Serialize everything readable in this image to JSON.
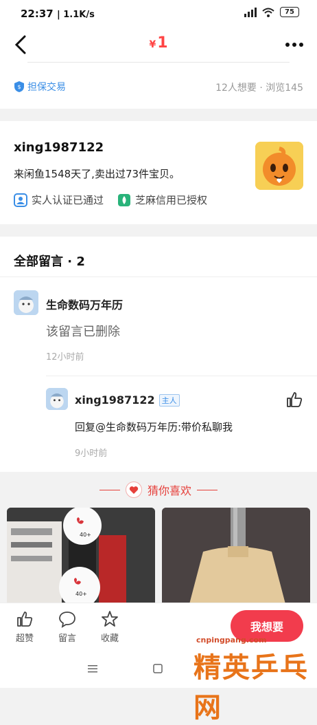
{
  "status_bar": {
    "time": "22:37",
    "speed": "| 1.1K/s",
    "battery": "75"
  },
  "nav": {
    "currency": "¥",
    "price": "1"
  },
  "guarantee": {
    "label": "担保交易",
    "stats": "12人想要 · 浏览145"
  },
  "seller": {
    "name": "xing1987122",
    "description": "来闲鱼1548天了,卖出过73件宝贝。",
    "badge_verified": "实人认证已通过",
    "badge_credit": "芝麻信用已授权"
  },
  "comments": {
    "title": "全部留言 · 2",
    "items": [
      {
        "user": "生命数码万年历",
        "text": "该留言已删除",
        "time": "12小时前"
      },
      {
        "user": "xing1987122",
        "tag": "主人",
        "text": "回复@生命数码万年历:带价私聊我",
        "time": "9小时前"
      }
    ]
  },
  "recommend": {
    "title": "猜你喜欢"
  },
  "actions": {
    "like": "超赞",
    "comment": "留言",
    "favorite": "收藏",
    "want": "我想要"
  },
  "watermark": {
    "url": "cnpingpang.com",
    "brand": "精英乒乓网"
  },
  "colors": {
    "price": "#ff4444",
    "link_blue": "#3a8ee6",
    "want_button": "#f23c4d"
  }
}
